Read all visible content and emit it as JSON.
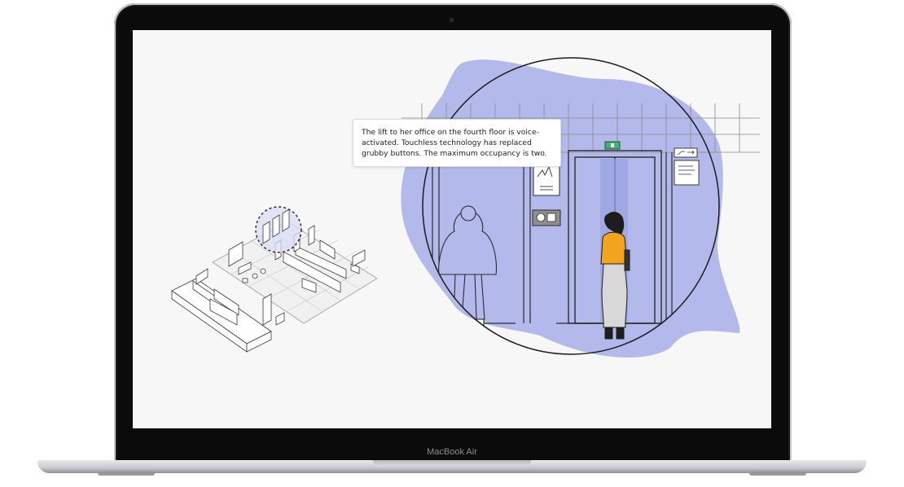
{
  "device": {
    "brand_label": "MacBook Air"
  },
  "story": {
    "caption": "The lift to her office on the fourth floor is voice-activated. Touchless technology has replaced grubby buttons. The maximum occupancy is two."
  },
  "colors": {
    "accent_purple": "#b3b9ea",
    "jacket_yellow": "#f2a41c",
    "lift_indicator_green": "#3bb86a",
    "line_dark": "#2b2b2b"
  },
  "icons": {
    "sign": "stairs-sign-icon",
    "panel": "lift-call-panel-icon",
    "indicator": "lift-indicator-icon"
  }
}
